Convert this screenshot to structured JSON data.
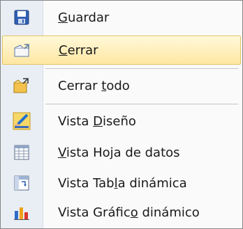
{
  "menu": {
    "items": [
      {
        "pre": "",
        "key": "G",
        "post": "uardar",
        "icon": "save-icon",
        "state": "normal"
      },
      {
        "pre": "",
        "key": "C",
        "post": "errar",
        "icon": "close-folder-icon",
        "state": "hover"
      },
      {
        "pre": "Cerrar ",
        "key": "t",
        "post": "odo",
        "icon": "close-all-folder-icon",
        "state": "normal"
      },
      {
        "pre": "Vista ",
        "key": "D",
        "post": "iseño",
        "icon": "design-view-icon",
        "state": "normal"
      },
      {
        "pre": "",
        "key": "V",
        "post": "ista Hoja de datos",
        "icon": "datasheet-view-icon",
        "state": "normal"
      },
      {
        "pre": "Vista Tab",
        "key": "l",
        "post": "a dinámica",
        "icon": "pivot-table-view-icon",
        "state": "normal"
      },
      {
        "pre": "Vista Gráfic",
        "key": "o",
        "post": " dinámico",
        "icon": "pivot-chart-view-icon",
        "state": "normal"
      }
    ]
  },
  "colors": {
    "highlight": "#ffe7a2",
    "gutter": "#e9eef5",
    "border": "#868686"
  }
}
